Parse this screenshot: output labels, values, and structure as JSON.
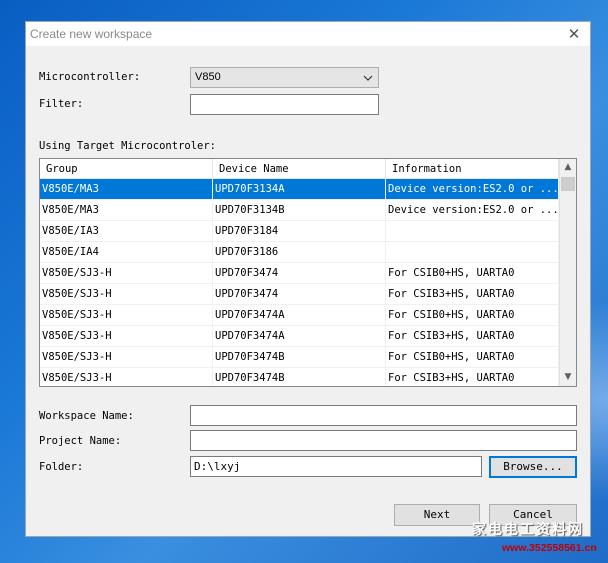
{
  "dialog": {
    "title": "Create new workspace",
    "close_glyph": "✕"
  },
  "form": {
    "microcontroller_label": "Microcontroller:",
    "microcontroller_value": "V850",
    "filter_label": "Filter:",
    "filter_value": "",
    "using_label": "Using Target Microcontroler:",
    "workspace_label": "Workspace Name:",
    "workspace_value": "",
    "project_label": "Project Name:",
    "project_value": "",
    "folder_label": "Folder:",
    "folder_value": "D:\\lxyj",
    "browse_label": "Browse..."
  },
  "table": {
    "columns": [
      "Group",
      "Device Name",
      "Information"
    ],
    "selected_index": 0,
    "rows": [
      [
        "V850E/MA3",
        "UPD70F3134A",
        "Device version:ES2.0 or ..."
      ],
      [
        "V850E/MA3",
        "UPD70F3134B",
        "Device version:ES2.0 or ..."
      ],
      [
        "V850E/IA3",
        "UPD70F3184",
        ""
      ],
      [
        "V850E/IA4",
        "UPD70F3186",
        ""
      ],
      [
        "V850E/SJ3-H",
        "UPD70F3474",
        "For CSIB0+HS, UARTA0"
      ],
      [
        "V850E/SJ3-H",
        "UPD70F3474",
        "For CSIB3+HS, UARTA0"
      ],
      [
        "V850E/SJ3-H",
        "UPD70F3474A",
        "For CSIB0+HS, UARTA0"
      ],
      [
        "V850E/SJ3-H",
        "UPD70F3474A",
        "For CSIB3+HS, UARTA0"
      ],
      [
        "V850E/SJ3-H",
        "UPD70F3474B",
        "For CSIB0+HS, UARTA0"
      ],
      [
        "V850E/SJ3-H",
        "UPD70F3474B",
        "For CSIB3+HS, UARTA0"
      ]
    ]
  },
  "buttons": {
    "next": "Next",
    "cancel": "Cancel"
  },
  "watermark": {
    "line1": "家电电工资料网",
    "line2": "www.352558561.cn"
  },
  "colors": {
    "selection": "#0078d7",
    "dialog_bg": "#f0f0f0",
    "desktop": "#1a78d6"
  }
}
